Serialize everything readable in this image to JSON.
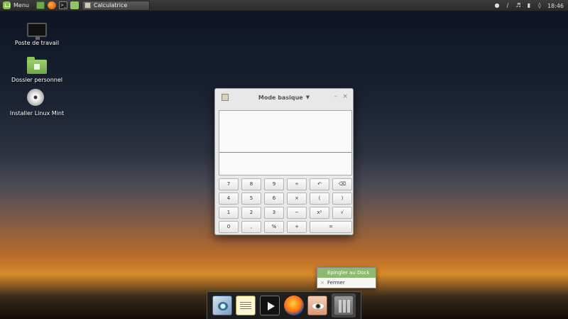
{
  "top_panel": {
    "menu_label": "Menu",
    "launchers": [
      "system-monitor-icon",
      "firefox-icon",
      "terminal-icon",
      "folder-icon"
    ],
    "task": {
      "label": "Calculatrice"
    },
    "clock": "18:46",
    "tray_icons": [
      "user-icon",
      "network-icon",
      "volume-icon",
      "battery-icon",
      "notification-icon"
    ]
  },
  "desktop": {
    "icons": [
      {
        "label": "Poste de travail",
        "icon": "computer-icon"
      },
      {
        "label": "Dossier personnel",
        "icon": "home-folder-icon"
      },
      {
        "label": "Installer Linux Mint",
        "icon": "disc-icon"
      }
    ]
  },
  "calculator": {
    "title": "Mode basique",
    "keys": {
      "row1": [
        "7",
        "8",
        "9",
        "÷",
        "↶",
        "⌫"
      ],
      "row2": [
        "4",
        "5",
        "6",
        "×",
        "(",
        ")"
      ],
      "row3": [
        "1",
        "2",
        "3",
        "−",
        "x²",
        "√"
      ],
      "row4": [
        "0",
        ",",
        "%",
        "+",
        "="
      ]
    }
  },
  "context_menu": {
    "items": [
      {
        "label": "Epingler au Dock"
      },
      {
        "label": "Fermer"
      }
    ]
  },
  "dock": {
    "items": [
      "mail-icon",
      "text-editor-icon",
      "video-player-icon",
      "firefox-icon",
      "eye-of-gnome-icon",
      "calculator-icon"
    ]
  },
  "colors": {
    "menu_highlight": "#8fb870",
    "panel": "#2a2a2a",
    "mint_green": "#87c05a"
  }
}
